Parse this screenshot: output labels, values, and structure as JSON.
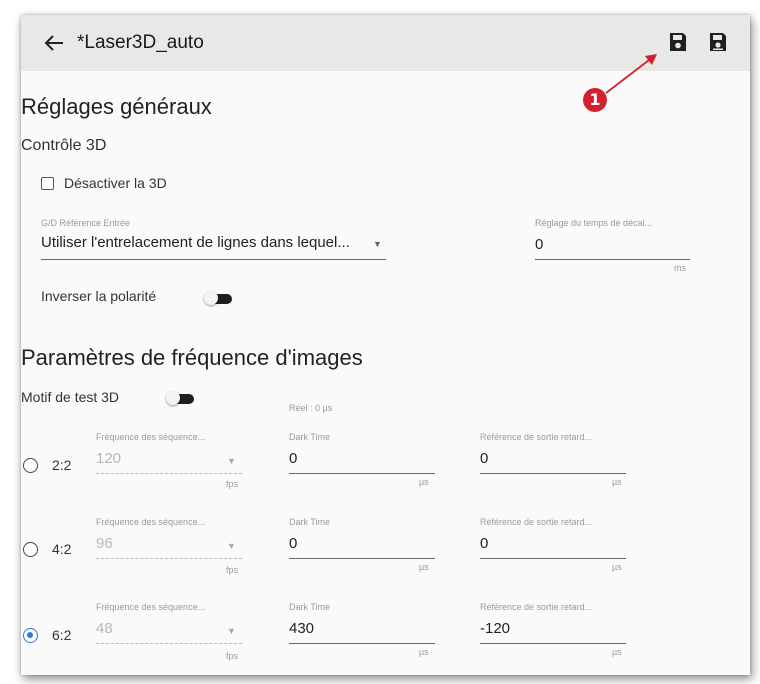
{
  "header": {
    "title": "*Laser3D_auto"
  },
  "badge": "1",
  "general": {
    "heading": "Réglages généraux",
    "control_heading": "Contrôle 3D",
    "disable_3d_label": "Désactiver la 3D",
    "disable_3d_checked": false,
    "lr_ref_label": "G/D Référence Entrée",
    "lr_ref_value": "Utiliser l'entrelacement de lignes dans lequel...",
    "delay_label": "Réglage du temps de décal...",
    "delay_value": "0",
    "delay_unit": "ms",
    "invert_polarity_label": "Inverser la polarité",
    "invert_polarity_on": false
  },
  "framerate": {
    "heading": "Paramètres de fréquence d'images",
    "test_pattern_label": "Motif de test 3D",
    "test_pattern_on": false,
    "real_label": "Réel : 0 µs",
    "rows": [
      {
        "ratio": "2:2",
        "checked": false,
        "seq_label": "Fréquence des séquence...",
        "seq_value": "120",
        "seq_unit": "fps",
        "dark_label": "Dark Time",
        "dark_value": "0",
        "dark_unit": "µs",
        "ref_label": "Référence de sortie retard...",
        "ref_value": "0",
        "ref_unit": "µs"
      },
      {
        "ratio": "4:2",
        "checked": false,
        "seq_label": "Fréquence des séquence...",
        "seq_value": "96",
        "seq_unit": "fps",
        "dark_label": "Dark Time",
        "dark_value": "0",
        "dark_unit": "µs",
        "ref_label": "Référence de sortie retard...",
        "ref_value": "0",
        "ref_unit": "µs"
      },
      {
        "ratio": "6:2",
        "checked": true,
        "seq_label": "Fréquence des séquence...",
        "seq_value": "48",
        "seq_unit": "fps",
        "dark_label": "Dark Time",
        "dark_value": "430",
        "dark_unit": "µs",
        "ref_label": "Référence de sortie retard...",
        "ref_value": "-120",
        "ref_unit": "µs"
      }
    ]
  },
  "colors": {
    "accent": "#2a7de1",
    "badge": "#d3202e",
    "header_bg": "#e8e8e6"
  },
  "icons": [
    "arrow-left-icon",
    "save-icon",
    "save-as-icon"
  ]
}
